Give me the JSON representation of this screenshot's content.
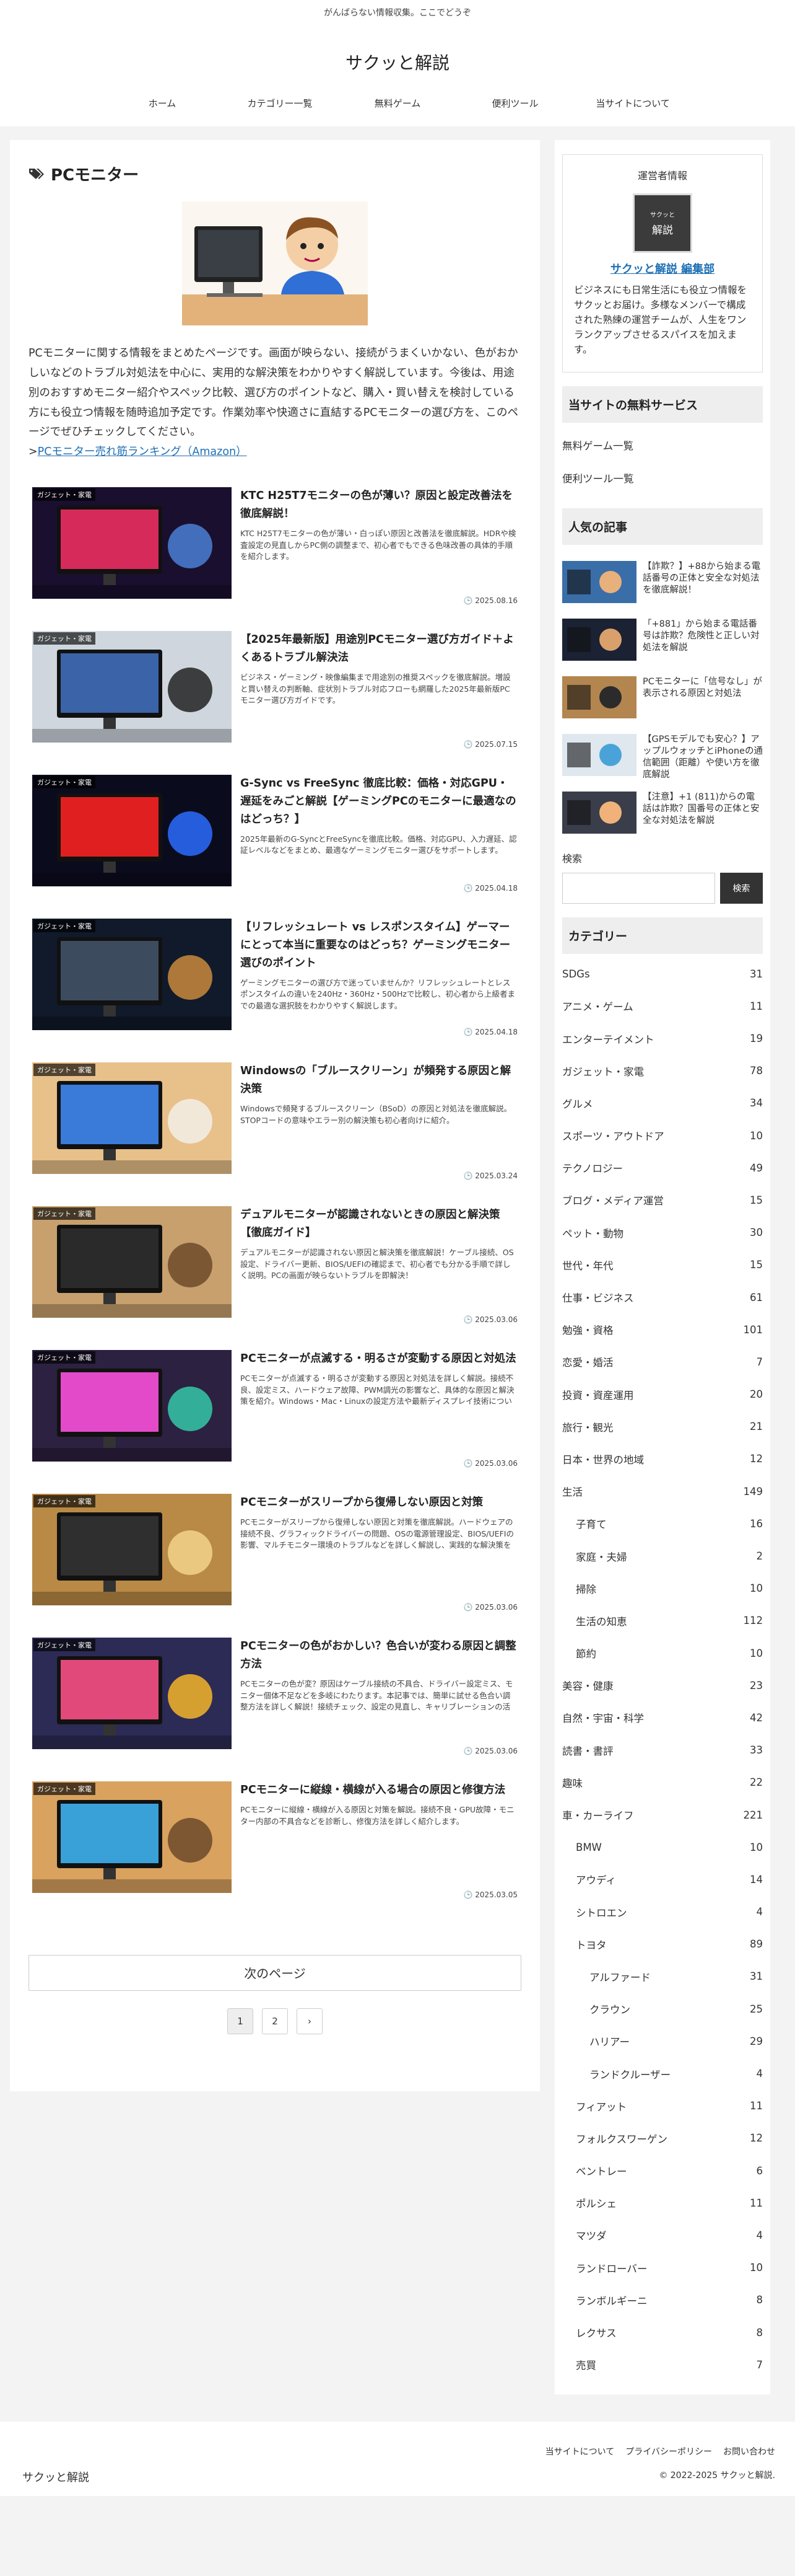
{
  "header": {
    "tagline": "がんばらない情報収集。ここでどうぞ",
    "title": "サクッと解説",
    "nav": [
      "ホーム",
      "カテゴリー一覧",
      "無料ゲーム",
      "便利ツール",
      "当サイトについて"
    ]
  },
  "archive": {
    "title": "PCモニター",
    "description": "PCモニターに関する情報をまとめたページです。画面が映らない、接続がうまくいかない、色がおかしいなどのトラブル対処法を中心に、実用的な解決策をわかりやすく解説しています。今後は、用途別のおすすめモニター紹介やスペック比較、選び方のポイントなど、購入・買い替えを検討している方にも役立つ情報を随時追加予定です。作業効率や快適さに直結するPCモニターの選び方を、このページでぜひチェックしてください。",
    "link_prefix": ">",
    "link_text": "PCモニター売れ筋ランキング（Amazon）"
  },
  "posts": [
    {
      "label": "ガジェット・家電",
      "title": "KTC H25T7モニターの色が薄い？原因と設定改善法を徹底解説！",
      "snippet": "KTC H25T7モニターの色が薄い・白っぽい原因と改善法を徹底解説。HDRや検査設定の見直しからPC側の調整まで、初心者でもできる色味改善の具体的手順を紹介します。",
      "date": "2025.08.16"
    },
    {
      "label": "ガジェット・家電",
      "title": "【2025年最新版】用途別PCモニター選び方ガイド＋よくあるトラブル解決法",
      "snippet": "ビジネス・ゲーミング・映像編集まで用途別の推奨スペックを徹底解説。増設と買い替えの判断軸、症状別トラブル対応フローも網羅した2025年最新版PCモニター選び方ガイドです。",
      "date": "2025.07.15"
    },
    {
      "label": "ガジェット・家電",
      "title": "G-Sync vs FreeSync 徹底比較：価格・対応GPU・遅延をみごと解説【ゲーミングPCのモニターに最適なのはどっち？】",
      "snippet": "2025年最新のG-SyncとFreeSyncを徹底比較。価格、対応GPU、入力遅延、認証レベルなどをまとめ、最適なゲーミングモニター選びをサポートします。",
      "date": "2025.04.18"
    },
    {
      "label": "ガジェット・家電",
      "title": "【リフレッシュレート vs レスポンスタイム】ゲーマーにとって本当に重要なのはどっち？ゲーミングモニター選びのポイント",
      "snippet": "ゲーミングモニターの選び方で迷っていませんか？リフレッシュレートとレスポンスタイムの違いを240Hz・360Hz・500Hzで比較し、初心者から上級者までの最適な選択肢をわかりやすく解説します。",
      "date": "2025.04.18"
    },
    {
      "label": "ガジェット・家電",
      "title": "Windowsの「ブルースクリーン」が頻発する原因と解決策",
      "snippet": "Windowsで頻発するブルースクリーン（BSoD）の原因と対処法を徹底解説。STOPコードの意味やエラー別の解決策も初心者向けに紹介。",
      "date": "2025.03.24"
    },
    {
      "label": "ガジェット・家電",
      "title": "デュアルモニターが認識されないときの原因と解決策【徹底ガイド】",
      "snippet": "デュアルモニターが認識されない原因と解決策を徹底解説！ケーブル接続、OS設定、ドライバー更新、BIOS/UEFIの確認まで、初心者でも分かる手順で詳しく説明。PCの画面が映らないトラブルを即解決！",
      "date": "2025.03.06"
    },
    {
      "label": "ガジェット・家電",
      "title": "PCモニターが点滅する・明るさが変動する原因と対処法",
      "snippet": "PCモニターが点滅する・明るさが変動する原因と対処法を詳しく解説。接続不良、設定ミス、ハードウェア故障、PWM調光の影響など、具体的な原因と解決策を紹介。Windows・Mac・Linuxの設定方法や最新ディスプレイ技術についてもカバーし、快適な作業環…",
      "date": "2025.03.06"
    },
    {
      "label": "ガジェット・家電",
      "title": "PCモニターがスリープから復帰しない原因と対策",
      "snippet": "PCモニターがスリープから復帰しない原因と対策を徹底解説。ハードウェアの接続不良、グラフィックドライバーの問題、OSの電源管理設定、BIOS/UEFIの影響、マルチモニター環境のトラブルなどを詳しく解説し、実践的な解決策を紹介。Windows・macOS・Lin…",
      "date": "2025.03.06"
    },
    {
      "label": "ガジェット・家電",
      "title": "PCモニターの色がおかしい？色合いが変わる原因と調整方法",
      "snippet": "PCモニターの色が変？原因はケーブル接続の不具合、ドライバー設定ミス、モニター個体不足などを多岐にわたります。本記事では、簡単に試せる色合い調整方法を詳しく解説！接続チェック、設定の見直し、キャリブレーションの活用で最適な画質を取り戻そう！",
      "date": "2025.03.06"
    },
    {
      "label": "ガジェット・家電",
      "title": "PCモニターに縦線・横線が入る場合の原因と修復方法",
      "snippet": "PCモニターに縦線・横線が入る原因と対策を解説。接続不良・GPU故障・モニター内部の不具合などを診断し、修復方法を詳しく紹介します。",
      "date": "2025.03.05"
    }
  ],
  "pagination": {
    "next_label": "次のページ",
    "pages": [
      "1",
      "2",
      "›"
    ]
  },
  "sidebar": {
    "operator": {
      "heading": "運営者情報",
      "logo_small": "サクッと",
      "logo_large": "解説",
      "name": "サクッと解説 編集部",
      "text": "ビジネスにも日常生活にも役立つ情報をサクッとお届け。多様なメンバーで構成された熟練の運営チームが、人生をワンランクアップさせるスパイスを加えます。"
    },
    "free_title": "当サイトの無料サービス",
    "free_items": [
      "無料ゲーム一覧",
      "便利ツール一覧"
    ],
    "popular_title": "人気の記事",
    "popular": [
      "【詐欺？】+88から始まる電話番号の正体と安全な対処法を徹底解説！",
      "「+881」から始まる電話番号は詐欺？危険性と正しい対処法を解説",
      "PCモニターに「信号なし」が表示される原因と対処法",
      "【GPSモデルでも安心？】アップルウォッチとiPhoneの通信範囲（距離）や使い方を徹底解説",
      "【注意】+1 (811)からの電話は詐欺？国番号の正体と安全な対処法を解説"
    ],
    "search_label": "検索",
    "search_button": "検索",
    "category_title": "カテゴリー",
    "categories": [
      {
        "name": "SDGs",
        "count": "31",
        "level": 0
      },
      {
        "name": "アニメ・ゲーム",
        "count": "11",
        "level": 0
      },
      {
        "name": "エンターテイメント",
        "count": "19",
        "level": 0
      },
      {
        "name": "ガジェット・家電",
        "count": "78",
        "level": 0
      },
      {
        "name": "グルメ",
        "count": "34",
        "level": 0
      },
      {
        "name": "スポーツ・アウトドア",
        "count": "10",
        "level": 0
      },
      {
        "name": "テクノロジー",
        "count": "49",
        "level": 0
      },
      {
        "name": "ブログ・メディア運営",
        "count": "15",
        "level": 0
      },
      {
        "name": "ペット・動物",
        "count": "30",
        "level": 0
      },
      {
        "name": "世代・年代",
        "count": "15",
        "level": 0
      },
      {
        "name": "仕事・ビジネス",
        "count": "61",
        "level": 0
      },
      {
        "name": "勉強・資格",
        "count": "101",
        "level": 0
      },
      {
        "name": "恋愛・婚活",
        "count": "7",
        "level": 0
      },
      {
        "name": "投資・資産運用",
        "count": "20",
        "level": 0
      },
      {
        "name": "旅行・観光",
        "count": "21",
        "level": 0
      },
      {
        "name": "日本・世界の地域",
        "count": "12",
        "level": 0
      },
      {
        "name": "生活",
        "count": "149",
        "level": 0
      },
      {
        "name": "子育て",
        "count": "16",
        "level": 1
      },
      {
        "name": "家庭・夫婦",
        "count": "2",
        "level": 1
      },
      {
        "name": "掃除",
        "count": "10",
        "level": 1
      },
      {
        "name": "生活の知恵",
        "count": "112",
        "level": 1
      },
      {
        "name": "節約",
        "count": "10",
        "level": 1
      },
      {
        "name": "美容・健康",
        "count": "23",
        "level": 0
      },
      {
        "name": "自然・宇宙・科学",
        "count": "42",
        "level": 0
      },
      {
        "name": "読書・書評",
        "count": "33",
        "level": 0
      },
      {
        "name": "趣味",
        "count": "22",
        "level": 0
      },
      {
        "name": "車・カーライフ",
        "count": "221",
        "level": 0
      },
      {
        "name": "BMW",
        "count": "10",
        "level": 1
      },
      {
        "name": "アウディ",
        "count": "14",
        "level": 1
      },
      {
        "name": "シトロエン",
        "count": "4",
        "level": 1
      },
      {
        "name": "トヨタ",
        "count": "89",
        "level": 1
      },
      {
        "name": "アルファード",
        "count": "31",
        "level": 2
      },
      {
        "name": "クラウン",
        "count": "25",
        "level": 2
      },
      {
        "name": "ハリアー",
        "count": "29",
        "level": 2
      },
      {
        "name": "ランドクルーザー",
        "count": "4",
        "level": 2
      },
      {
        "name": "フィアット",
        "count": "11",
        "level": 1
      },
      {
        "name": "フォルクスワーゲン",
        "count": "12",
        "level": 1
      },
      {
        "name": "ベントレー",
        "count": "6",
        "level": 1
      },
      {
        "name": "ポルシェ",
        "count": "11",
        "level": 1
      },
      {
        "name": "マツダ",
        "count": "4",
        "level": 1
      },
      {
        "name": "ランドローバー",
        "count": "10",
        "level": 1
      },
      {
        "name": "ランボルギーニ",
        "count": "8",
        "level": 1
      },
      {
        "name": "レクサス",
        "count": "8",
        "level": 1
      },
      {
        "name": "売買",
        "count": "7",
        "level": 1
      }
    ]
  },
  "footer": {
    "links": [
      "当サイトについて",
      "プライバシーポリシー",
      "お問い合わせ"
    ],
    "site_name": "サクッと解説",
    "copyright": "© 2022-2025 サクッと解説."
  },
  "colors": {
    "accent": "#1e6fb3",
    "button": "#333333"
  }
}
